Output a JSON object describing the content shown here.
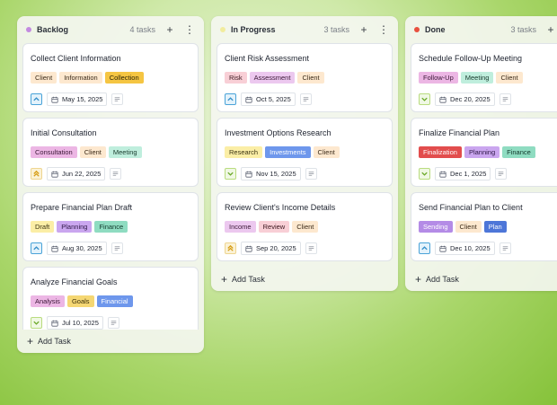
{
  "columns": [
    {
      "title": "Backlog",
      "count": "4 tasks",
      "dot_color": "#c38ae0",
      "cards": [
        {
          "title": "Collect Client Information",
          "tags": [
            "Client",
            "Information",
            "Collection"
          ],
          "date": "May 15, 2025",
          "priority": "up"
        },
        {
          "title": "Initial Consultation",
          "tags": [
            "Consultation",
            "Client",
            "Meeting"
          ],
          "date": "Jun 22, 2025",
          "priority": "double"
        },
        {
          "title": "Prepare Financial Plan Draft",
          "tags": [
            "Draft",
            "Planning",
            "Finance"
          ],
          "date": "Aug 30, 2025",
          "priority": "up"
        },
        {
          "title": "Analyze Financial Goals",
          "tags": [
            "Analysis",
            "Goals",
            "Financial"
          ],
          "date": "Jul 10, 2025",
          "priority": "down"
        }
      ],
      "add_label": "Add Task"
    },
    {
      "title": "In Progress",
      "count": "3 tasks",
      "dot_color": "#f1ec9e",
      "cards": [
        {
          "title": "Client Risk Assessment",
          "tags": [
            "Risk",
            "Assessment",
            "Client"
          ],
          "date": "Oct 5, 2025",
          "priority": "up"
        },
        {
          "title": "Investment Options Research",
          "tags": [
            "Research",
            "Investments",
            "Client"
          ],
          "date": "Nov 15, 2025",
          "priority": "down"
        },
        {
          "title": "Review Client's Income Details",
          "tags": [
            "Income",
            "Review",
            "Client"
          ],
          "date": "Sep 20, 2025",
          "priority": "double"
        }
      ],
      "add_label": "Add Task"
    },
    {
      "title": "Done",
      "count": "3 tasks",
      "dot_color": "#e8503e",
      "cards": [
        {
          "title": "Schedule Follow-Up Meeting",
          "tags": [
            "Follow-Up",
            "Meeting",
            "Client"
          ],
          "date": "Dec 20, 2025",
          "priority": "down"
        },
        {
          "title": "Finalize Financial Plan",
          "tags": [
            "Finalization",
            "Planning",
            "Finance"
          ],
          "date": "Dec 1, 2025",
          "priority": "down"
        },
        {
          "title": "Send Financial Plan to Client",
          "tags": [
            "Sending",
            "Client",
            "Plan"
          ],
          "date": "Dec 10, 2025",
          "priority": "up"
        }
      ],
      "add_label": "Add Task"
    }
  ],
  "tag_colors": {
    "Client": {
      "bg": "#fde8cf",
      "fg": "#3a2a18"
    },
    "Information": {
      "bg": "#fde8cf",
      "fg": "#3a2a18"
    },
    "Collection": {
      "bg": "#f5c542",
      "fg": "#2a2205"
    },
    "Consultation": {
      "bg": "#ecb6e4",
      "fg": "#3a1736"
    },
    "Meeting": {
      "bg": "#bfeedd",
      "fg": "#173a2c"
    },
    "Draft": {
      "bg": "#fbeea6",
      "fg": "#3a3312"
    },
    "Planning": {
      "bg": "#caa6ef",
      "fg": "#2d1746"
    },
    "Finance": {
      "bg": "#8fdcc1",
      "fg": "#12392c"
    },
    "Analysis": {
      "bg": "#ecb6e4",
      "fg": "#3a1736"
    },
    "Goals": {
      "bg": "#f5d773",
      "fg": "#3a2e08"
    },
    "Financial": {
      "bg": "#6e97ec",
      "fg": "#ffffff"
    },
    "Risk": {
      "bg": "#f8cfd6",
      "fg": "#3a161d"
    },
    "Assessment": {
      "bg": "#ecc8ef",
      "fg": "#3a1736"
    },
    "Research": {
      "bg": "#fbeea6",
      "fg": "#3a3312"
    },
    "Investments": {
      "bg": "#6e97ec",
      "fg": "#ffffff"
    },
    "Income": {
      "bg": "#ecc8ef",
      "fg": "#3a1736"
    },
    "Review": {
      "bg": "#f8cfd6",
      "fg": "#3a161d"
    },
    "Follow-Up": {
      "bg": "#ecb6e4",
      "fg": "#3a1736"
    },
    "Finalization": {
      "bg": "#e24d4d",
      "fg": "#ffffff"
    },
    "Sending": {
      "bg": "#b48be6",
      "fg": "#ffffff"
    },
    "Plan": {
      "bg": "#4d76d8",
      "fg": "#ffffff"
    }
  },
  "icons": {
    "add": "plus-icon",
    "more": "more-vertical-icon",
    "calendar": "calendar-icon",
    "notes": "notes-icon",
    "priority_up": "chevron-up-icon",
    "priority_down": "chevron-down-icon",
    "priority_double": "double-chevron-up-icon"
  }
}
